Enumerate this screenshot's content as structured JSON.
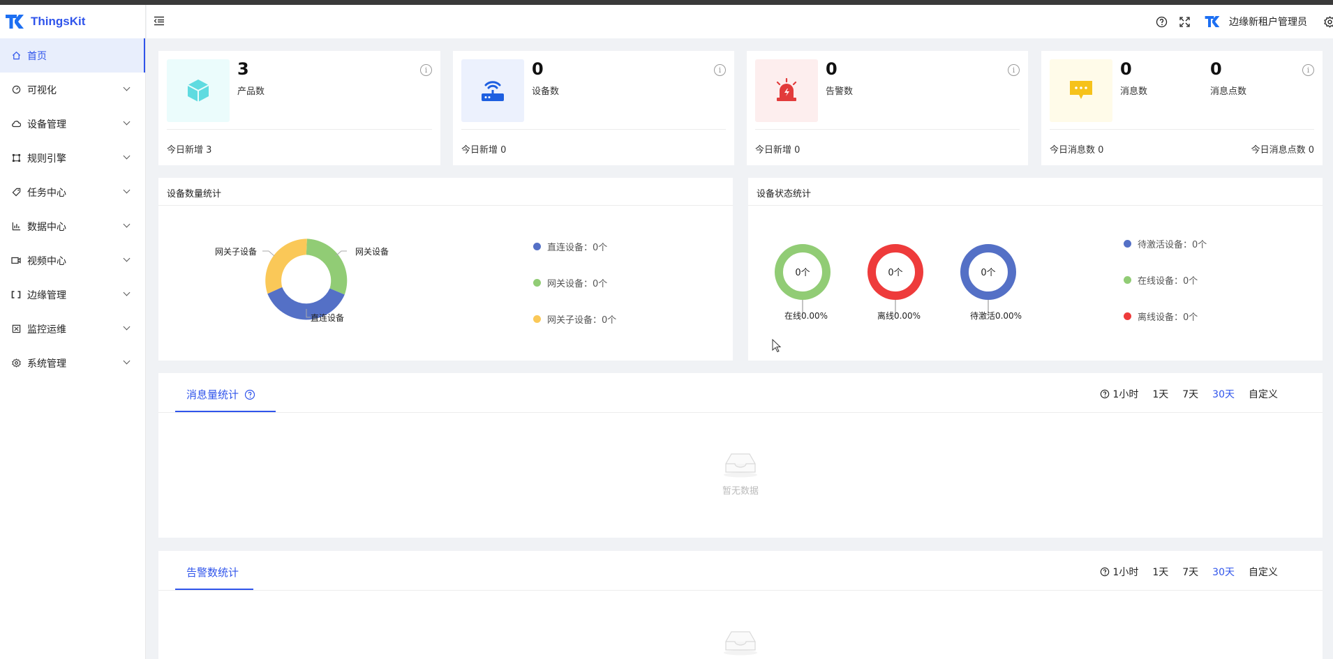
{
  "app": {
    "name": "ThingsKit"
  },
  "sidebar": {
    "items": [
      {
        "label": "首页",
        "icon": "home-icon"
      },
      {
        "label": "可视化",
        "icon": "dashboard-icon"
      },
      {
        "label": "设备管理",
        "icon": "cloud-icon"
      },
      {
        "label": "规则引擎",
        "icon": "rule-icon"
      },
      {
        "label": "任务中心",
        "icon": "tag-icon"
      },
      {
        "label": "数据中心",
        "icon": "chart-icon"
      },
      {
        "label": "视频中心",
        "icon": "video-icon"
      },
      {
        "label": "边缘管理",
        "icon": "edge-icon"
      },
      {
        "label": "监控运维",
        "icon": "monitor-icon"
      },
      {
        "label": "系统管理",
        "icon": "gear-icon"
      }
    ]
  },
  "header": {
    "user": "边缘新租户管理员"
  },
  "stats": {
    "products": {
      "value": "3",
      "label": "产品数",
      "foot": "今日新增 3"
    },
    "devices": {
      "value": "0",
      "label": "设备数",
      "foot": "今日新增 0"
    },
    "alarms": {
      "value": "0",
      "label": "告警数",
      "foot": "今日新增 0"
    },
    "messages": {
      "value": "0",
      "label": "消息数",
      "value2": "0",
      "label2": "消息点数",
      "foot": "今日消息数 0",
      "foot2": "今日消息点数 0"
    }
  },
  "device_count": {
    "title": "设备数量统计",
    "labels": {
      "direct": "直连设备",
      "gateway": "网关设备",
      "sub": "网关子设备"
    },
    "legend": [
      {
        "name": "直连设备：",
        "value": "0个",
        "color": "#5470c6"
      },
      {
        "name": "网关设备：",
        "value": "0个",
        "color": "#91cc75"
      },
      {
        "name": "网关子设备：",
        "value": "0个",
        "color": "#fac858"
      }
    ]
  },
  "device_status": {
    "title": "设备状态统计",
    "rings": [
      {
        "center": "0个",
        "caption": "在线0.00%",
        "color": "#91cc75"
      },
      {
        "center": "0个",
        "caption": "离线0.00%",
        "color": "#ee3b3b"
      },
      {
        "center": "0个",
        "caption": "待激活0.00%",
        "color": "#5470c6"
      }
    ],
    "legend": [
      {
        "name": "待激活设备：",
        "value": "0个",
        "color": "#5470c6"
      },
      {
        "name": "在线设备：",
        "value": "0个",
        "color": "#91cc75"
      },
      {
        "name": "离线设备：",
        "value": "0个",
        "color": "#ee3b3b"
      }
    ]
  },
  "message_stats": {
    "title": "消息量统计",
    "empty": "暂无数据"
  },
  "alarm_stats": {
    "title": "告警数统计"
  },
  "ranges": {
    "hour": "1小时",
    "day": "1天",
    "week": "7天",
    "month": "30天",
    "custom": "自定义"
  },
  "colors": {
    "accent": "#2f54eb"
  }
}
